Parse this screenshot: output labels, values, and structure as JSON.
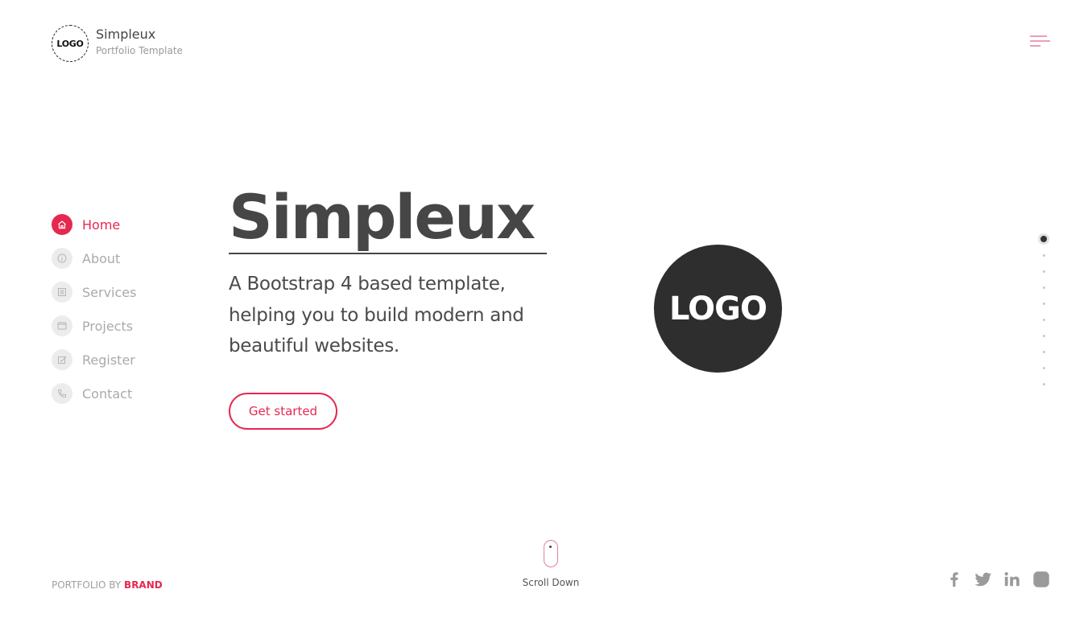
{
  "header": {
    "logo_text": "LOGO",
    "brand_name": "Simpleux",
    "brand_tagline": "Portfolio Template",
    "menu_icon": "hamburger-menu-icon"
  },
  "sidebar": {
    "items": [
      {
        "label": "Home",
        "icon": "home-icon",
        "active": true
      },
      {
        "label": "About",
        "icon": "info-icon",
        "active": false
      },
      {
        "label": "Services",
        "icon": "list-icon",
        "active": false
      },
      {
        "label": "Projects",
        "icon": "window-icon",
        "active": false
      },
      {
        "label": "Register",
        "icon": "edit-icon",
        "active": false
      },
      {
        "label": "Contact",
        "icon": "phone-icon",
        "active": false
      }
    ]
  },
  "hero": {
    "title": "Simpleux",
    "subtitle": "A Bootstrap 4 based template, helping you to build modern and beautiful websites.",
    "cta_label": "Get started",
    "logo_text": "LOGO"
  },
  "section_dots": {
    "count": 10,
    "active_index": 0
  },
  "footer": {
    "credit_prefix": "PORTFOLIO BY",
    "credit_brand": "BRAND",
    "scroll_label": "Scroll Down",
    "social": [
      "facebook-icon",
      "twitter-icon",
      "linkedin-icon",
      "instagram-icon"
    ]
  },
  "colors": {
    "accent": "#e6284f",
    "text_dark": "#464646",
    "muted": "#aaaaaa",
    "logo_bg": "#2e2e2e"
  }
}
